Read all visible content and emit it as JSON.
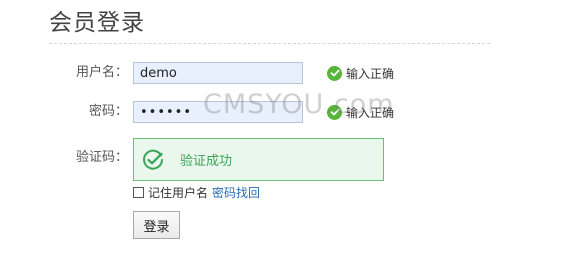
{
  "header": {
    "title": "会员登录"
  },
  "watermark": "CMSYOU.com",
  "form": {
    "username": {
      "label": "用户名：",
      "value": "demo",
      "hint": "输入正确"
    },
    "password": {
      "label": "密码：",
      "value": "••••••",
      "hint": "输入正确"
    },
    "captcha": {
      "label": "验证码：",
      "status": "验证成功"
    },
    "remember": {
      "label": "记住用户名",
      "checked": false
    },
    "forgot_link": "密码找回",
    "submit_label": "登录"
  },
  "colors": {
    "success_green": "#57b53a",
    "captcha_border": "#68c07d",
    "captcha_bg": "#e9f7ec",
    "input_bg": "#e8f0fe",
    "link": "#2a6bb0"
  },
  "icons": {
    "hint": "check-circle-icon",
    "captcha": "check-circle-outline-icon"
  }
}
